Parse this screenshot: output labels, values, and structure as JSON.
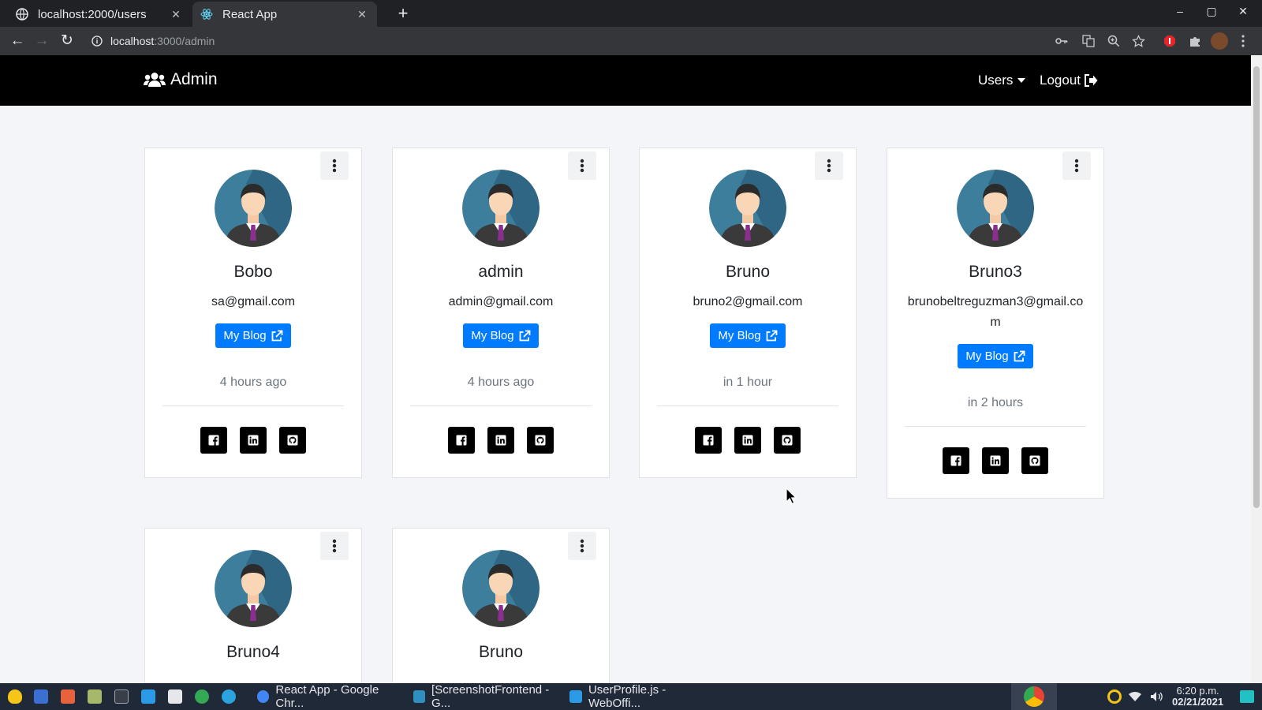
{
  "browser": {
    "tabs": [
      {
        "title": "localhost:2000/users",
        "close": "✕",
        "active": false
      },
      {
        "title": "React App",
        "close": "✕",
        "active": true
      }
    ],
    "new_tab": "+",
    "url_host": "localhost",
    "url_path": ":3000/admin",
    "window_controls": {
      "minimize": "–",
      "maximize": "▢",
      "close": "✕"
    }
  },
  "navbar": {
    "brand": "Admin",
    "users_menu": "Users",
    "logout": "Logout"
  },
  "users": [
    {
      "name": "Bobo",
      "email": "sa@gmail.com",
      "blog_label": "My Blog",
      "time": "4 hours ago"
    },
    {
      "name": "admin",
      "email": "admin@gmail.com",
      "blog_label": "My Blog",
      "time": "4 hours ago"
    },
    {
      "name": "Bruno",
      "email": "bruno2@gmail.com",
      "blog_label": "My Blog",
      "time": "in 1 hour"
    },
    {
      "name": "Bruno3",
      "email": "brunobeltreguzman3@gmail.com",
      "blog_label": "My Blog",
      "time": "in 2 hours"
    },
    {
      "name": "Bruno4"
    },
    {
      "name": "Bruno"
    }
  ],
  "taskbar": {
    "windows": [
      {
        "title": "React App - Google Chr...",
        "color": "#4285f4"
      },
      {
        "title": "[ScreenshotFrontend - G...",
        "color": "#2f8fbf"
      },
      {
        "title": "UserProfile.js - WebOffi...",
        "color": "#2b9be8"
      }
    ],
    "time": "6:20 p.m.",
    "date": "02/21/2021"
  },
  "colors": {
    "primary": "#007bff",
    "navbar": "#000000",
    "page_bg": "#f3f5f9"
  }
}
